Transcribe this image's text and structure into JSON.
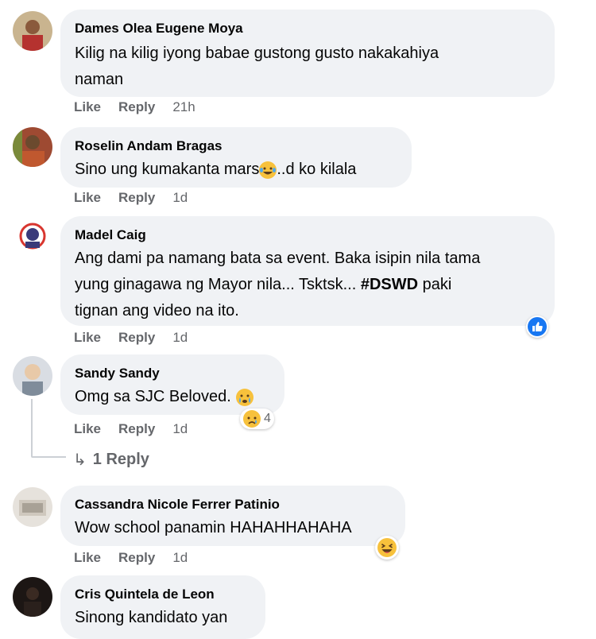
{
  "comments": [
    {
      "author": "Dames Olea Eugene Moya",
      "text_lines": [
        "Kilig na kilig iyong babae gustong gusto nakakahiya",
        "naman"
      ],
      "like": "Like",
      "reply": "Reply",
      "time": "21h"
    },
    {
      "author": "Roselin Andam Bragas",
      "text_before_emoji": "Sino ung kumakanta mars",
      "text_after_emoji": "..d ko kilala",
      "emoji": "laughing-crying-face",
      "like": "Like",
      "reply": "Reply",
      "time": "1d"
    },
    {
      "author": "Madel Caig",
      "text_lines": [
        "Ang dami pa namang bata sa event. Baka isipin nila tama",
        "yung ginagawa ng Mayor nila... Tsktsk... ",
        "tignan ang video na ito."
      ],
      "hashtag": "#DSWD",
      "hashtag_after": " paki",
      "reaction": "like-reaction",
      "like": "Like",
      "reply": "Reply",
      "time": "1d"
    },
    {
      "author": "Sandy Sandy",
      "text": "Omg sa SJC Beloved.",
      "emoji": "crying-face",
      "reaction": "sad-reaction",
      "reaction_count": "4",
      "like": "Like",
      "reply": "Reply",
      "time": "1d",
      "replies_label": "1 Reply"
    },
    {
      "author": "Cassandra Nicole Ferrer Patinio",
      "text": "Wow school panamin HAHAHHAHAHA",
      "reaction": "haha-reaction",
      "like": "Like",
      "reply": "Reply",
      "time": "1d"
    },
    {
      "author": "Cris Quintela de Leon",
      "text": "Sinong kandidato yan"
    }
  ],
  "colors": {
    "bubble": "#f0f2f5",
    "secondary_text": "#65676b",
    "like_blue": "#1877f2",
    "emoji_yellow": "#f7c13c"
  }
}
